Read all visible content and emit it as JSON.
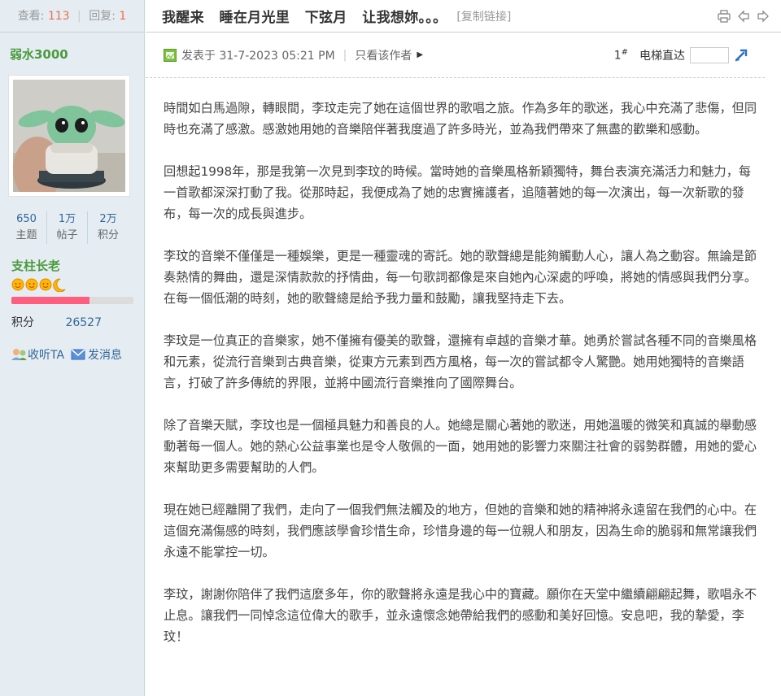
{
  "sidebar": {
    "stats": {
      "views_label": "查看:",
      "views": "113",
      "replies_label": "回复:",
      "replies": "1"
    },
    "author": "弱水3000",
    "counts": [
      {
        "value": "650",
        "label": "主题"
      },
      {
        "value": "1万",
        "label": "帖子"
      },
      {
        "value": "2万",
        "label": "积分"
      }
    ],
    "rank": "支柱长老",
    "progress_fraction": 0.64,
    "points_label": "积分",
    "points_value": "26527",
    "follow_label": "收听TA",
    "message_label": "发消息"
  },
  "header": {
    "title": "我醒来   睡在月光里   下弦月   让我想妳。。。",
    "copy_link": "[复制链接]"
  },
  "post": {
    "posted_at": "发表于 31-7-2023 05:21 PM",
    "author_only": "只看该作者",
    "floor": "1",
    "floor_sup": "#",
    "jump_label": "电梯直达",
    "paragraphs": [
      "時間如白馬過隙，轉眼間，李玟走完了她在這個世界的歌唱之旅。作為多年的歌迷，我心中充滿了悲傷，但同時也充滿了感激。感激她用她的音樂陪伴著我度過了許多時光，並為我們帶來了無盡的歡樂和感動。",
      "回想起1998年，那是我第一次見到李玟的時候。當時她的音樂風格新穎獨特，舞台表演充滿活力和魅力，每一首歌都深深打動了我。從那時起，我便成為了她的忠實擁護者，追隨著她的每一次演出，每一次新歌的發布，每一次的成長與進步。",
      "李玟的音樂不僅僅是一種娛樂，更是一種靈魂的寄託。她的歌聲總是能夠觸動人心，讓人為之動容。無論是節奏熱情的舞曲，還是深情款款的抒情曲，每一句歌詞都像是來自她內心深處的呼喚，將她的情感與我們分享。在每一個低潮的時刻，她的歌聲總是給予我力量和鼓勵，讓我堅持走下去。",
      "李玟是一位真正的音樂家，她不僅擁有優美的歌聲，還擁有卓越的音樂才華。她勇於嘗試各種不同的音樂風格和元素，從流行音樂到古典音樂，從東方元素到西方風格，每一次的嘗試都令人驚艷。她用她獨特的音樂語言，打破了許多傳統的界限，並將中國流行音樂推向了國際舞台。",
      "除了音樂天賦，李玟也是一個極具魅力和善良的人。她總是關心著她的歌迷，用她溫暖的微笑和真誠的舉動感動著每一個人。她的熱心公益事業也是令人敬佩的一面，她用她的影響力來關注社會的弱勢群體，用她的愛心來幫助更多需要幫助的人們。",
      "現在她已經離開了我們，走向了一個我們無法觸及的地方，但她的音樂和她的精神將永遠留在我們的心中。在這個充滿傷感的時刻，我們應該學會珍惜生命，珍惜身邊的每一位親人和朋友，因為生命的脆弱和無常讓我們永遠不能掌控一切。",
      "李玟，謝謝你陪伴了我們這麼多年，你的歌聲將永遠是我心中的寶藏。願你在天堂中繼續翩翩起舞，歌唱永不止息。讓我們一同悼念這位偉大的歌手，並永遠懷念她帶給我們的感動和美好回憶。安息吧，我的摯愛，李玟！"
    ]
  },
  "colors": {
    "sidebar_bg": "#e5edf2",
    "accent_green": "#4b9b3f",
    "link_blue": "#336699",
    "count_orange": "#f26c4f",
    "progress_pink": "#ff5e7e"
  }
}
